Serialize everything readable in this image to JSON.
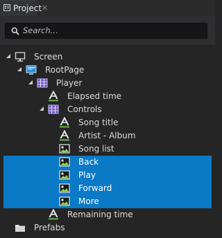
{
  "panel": {
    "title": "Project"
  },
  "search": {
    "placeholder": "Search..."
  },
  "tree": [
    {
      "label": "Screen",
      "icon": "monitor-icon",
      "depth": 0,
      "expanded": true,
      "selected": false
    },
    {
      "label": "RootPage",
      "icon": "page-icon",
      "depth": 1,
      "expanded": true,
      "selected": false
    },
    {
      "label": "Player",
      "icon": "grid-icon",
      "depth": 2,
      "expanded": true,
      "selected": false
    },
    {
      "label": "Elapsed time",
      "icon": "text-icon",
      "depth": 3,
      "expanded": null,
      "selected": false
    },
    {
      "label": "Controls",
      "icon": "grid-icon",
      "depth": 3,
      "expanded": true,
      "selected": false
    },
    {
      "label": "Song title",
      "icon": "text-icon",
      "depth": 4,
      "expanded": null,
      "selected": false
    },
    {
      "label": "Artist - Album",
      "icon": "text-icon",
      "depth": 4,
      "expanded": null,
      "selected": false
    },
    {
      "label": "Song list",
      "icon": "image-icon",
      "depth": 4,
      "expanded": null,
      "selected": false
    },
    {
      "label": "Back",
      "icon": "image-icon",
      "depth": 4,
      "expanded": null,
      "selected": true
    },
    {
      "label": "Play",
      "icon": "image-icon",
      "depth": 4,
      "expanded": null,
      "selected": true
    },
    {
      "label": "Forward",
      "icon": "image-icon",
      "depth": 4,
      "expanded": null,
      "selected": true
    },
    {
      "label": "More",
      "icon": "image-icon",
      "depth": 4,
      "expanded": null,
      "selected": true
    },
    {
      "label": "Remaining time",
      "icon": "text-icon",
      "depth": 3,
      "expanded": null,
      "selected": false
    },
    {
      "label": "Prefabs",
      "icon": "folder-icon",
      "depth": 0,
      "expanded": null,
      "selected": false
    }
  ],
  "colors": {
    "selection": "#0a79c6",
    "background": "#252526",
    "text": "#dcdcdc"
  }
}
